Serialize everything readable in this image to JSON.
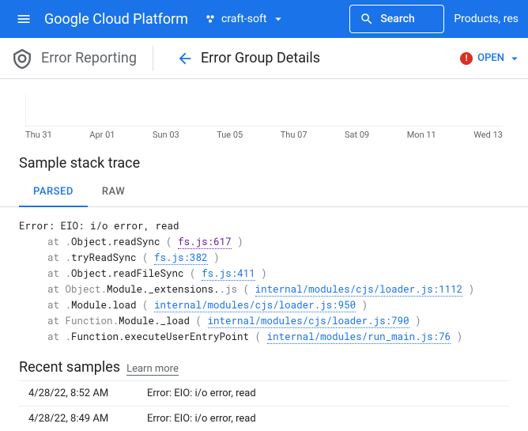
{
  "topbar": {
    "logo": "Google Cloud Platform",
    "project": "craft-soft",
    "search_label": "Search",
    "products_link": "Products, res"
  },
  "subbar": {
    "product": "Error Reporting",
    "page_title": "Error Group Details",
    "status": "OPEN"
  },
  "chart": {
    "ticks": [
      "Thu 31",
      "Apr 01",
      "Sun 03",
      "Tue 05",
      "Thu 07",
      "Sat 09",
      "Mon 11",
      "Wed 13"
    ]
  },
  "stack": {
    "heading": "Sample stack trace",
    "tabs": {
      "parsed": "PARSED",
      "raw": "RAW"
    },
    "error_line": "Error: EIO: i/o error, read",
    "frames": [
      {
        "pre_gray": "at .",
        "pre": "Object.readSync",
        "paren": " ( ",
        "link": "fs.js:617",
        "visited": true,
        "post": " )"
      },
      {
        "pre_gray": "at .",
        "pre": "tryReadSync",
        "paren": " ( ",
        "link": "fs.js:382",
        "visited": false,
        "post": " )"
      },
      {
        "pre_gray": "at .",
        "pre": "Object.readFileSync",
        "paren": " ( ",
        "link": "fs.js:411",
        "visited": false,
        "post": " )"
      },
      {
        "pre_gray": "at Object.",
        "pre": "Module._extensions.",
        "mid_gray": ".js",
        "paren": " ( ",
        "link": "internal/modules/cjs/loader.js:1112",
        "visited": false,
        "post": " )"
      },
      {
        "pre_gray": "at .",
        "pre": "Module.load",
        "paren": " ( ",
        "link": "internal/modules/cjs/loader.js:950",
        "visited": false,
        "post": " )"
      },
      {
        "pre_gray": "at Function.",
        "pre": "Module._load",
        "paren": " ( ",
        "link": "internal/modules/cjs/loader.js:790",
        "visited": false,
        "post": " )"
      },
      {
        "pre_gray": "at .",
        "pre": "Function.executeUserEntryPoint",
        "paren": " ( ",
        "link": "internal/modules/run_main.js:76",
        "visited": false,
        "post": " )"
      }
    ]
  },
  "recent": {
    "heading": "Recent samples",
    "learn": "Learn more",
    "rows": [
      {
        "ts": "4/28/22, 8:52 AM",
        "msg": "Error: EIO: i/o error, read"
      },
      {
        "ts": "4/28/22, 8:49 AM",
        "msg": "Error: EIO: i/o error, read"
      }
    ]
  }
}
